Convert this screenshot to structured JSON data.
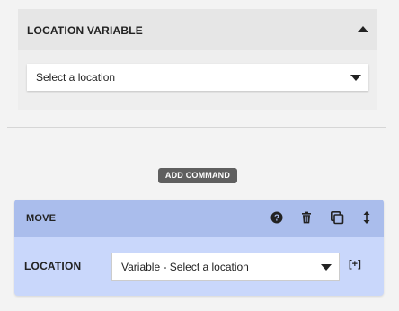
{
  "location_panel": {
    "title": "LOCATION VARIABLE",
    "select_value": "Select a location"
  },
  "add_command": {
    "label": "ADD COMMAND"
  },
  "command": {
    "title": "MOVE",
    "icons": [
      "help-icon",
      "trash-icon",
      "duplicate-icon",
      "reorder-icon"
    ],
    "location_label": "LOCATION",
    "location_value": "Variable - Select a location",
    "add_variable_label": "[+]"
  },
  "colors": {
    "page_bg": "#f3f3f3",
    "panel_bg": "#eeeeee",
    "panel_header_bg": "#e6e6e6",
    "command_header_bg": "#aabdec",
    "command_body_bg": "#c9d7fb",
    "button_bg": "#5f5f5f"
  }
}
